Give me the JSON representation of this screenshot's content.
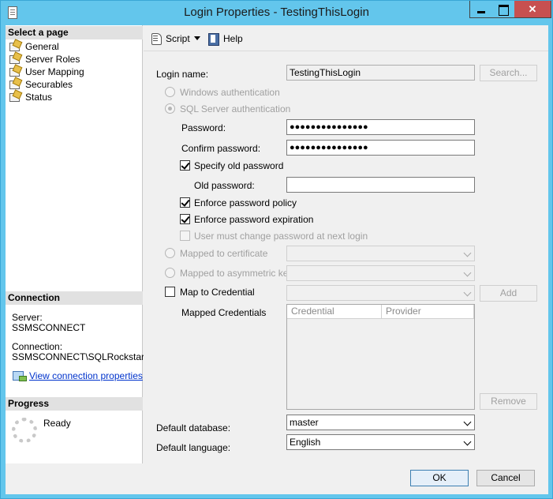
{
  "window": {
    "title": "Login Properties - TestingThisLogin"
  },
  "left": {
    "select_page_header": "Select a page",
    "pages": [
      {
        "label": "General"
      },
      {
        "label": "Server Roles"
      },
      {
        "label": "User Mapping"
      },
      {
        "label": "Securables"
      },
      {
        "label": "Status"
      }
    ],
    "connection_header": "Connection",
    "server_label": "Server:",
    "server_value": "SSMSCONNECT",
    "connection_label": "Connection:",
    "connection_value": "SSMSCONNECT\\SQLRockstar",
    "view_connection_link": "View connection properties",
    "progress_header": "Progress",
    "progress_status": "Ready"
  },
  "toolbar": {
    "script_label": "Script",
    "help_label": "Help"
  },
  "form": {
    "login_name_label": "Login name:",
    "login_name_value": "TestingThisLogin",
    "search_button": "Search...",
    "windows_auth_label": "Windows authentication",
    "sql_auth_label": "SQL Server authentication",
    "password_label": "Password:",
    "password_value": "●●●●●●●●●●●●●●●",
    "confirm_password_label": "Confirm password:",
    "confirm_password_value": "●●●●●●●●●●●●●●●",
    "specify_old_password_label": "Specify old password",
    "specify_old_password_checked": true,
    "old_password_label": "Old password:",
    "old_password_value": "",
    "enforce_policy_label": "Enforce password policy",
    "enforce_policy_checked": true,
    "enforce_expiration_label": "Enforce password expiration",
    "enforce_expiration_checked": true,
    "must_change_label": "User must change password at next login",
    "must_change_checked": false,
    "mapped_certificate_label": "Mapped to certificate",
    "mapped_asymmetric_key_label": "Mapped to asymmetric key",
    "map_credential_label": "Map to Credential",
    "map_credential_checked": false,
    "add_button": "Add",
    "mapped_credentials_label": "Mapped Credentials",
    "credentials_columns": [
      "Credential",
      "Provider"
    ],
    "remove_button": "Remove",
    "default_database_label": "Default database:",
    "default_database_value": "master",
    "default_language_label": "Default language:",
    "default_language_value": "English"
  },
  "footer": {
    "ok_button": "OK",
    "cancel_button": "Cancel"
  }
}
